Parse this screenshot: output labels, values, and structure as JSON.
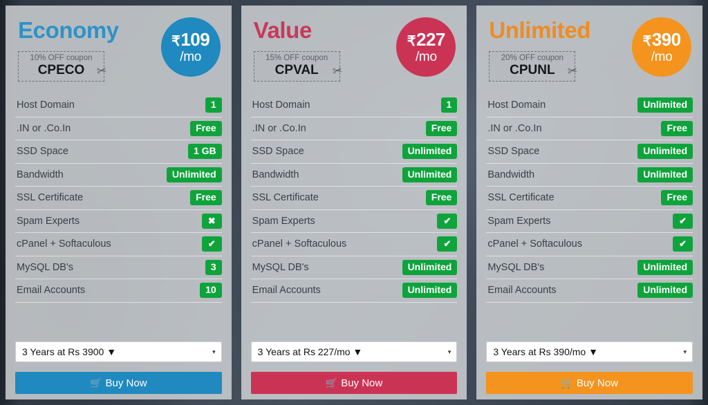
{
  "page": {
    "background_color": "#3b4450",
    "badge_color": "#0fa33c",
    "card_background": "rgba(205,208,211,0.86)"
  },
  "icons": {
    "scissors": "✂",
    "cart": "🛒",
    "check": "✔",
    "cross": "✖",
    "caret_down": "▼",
    "select_caret": "▾",
    "rupee": "₹"
  },
  "feature_labels": [
    "Host Domain",
    ".IN or .Co.In",
    "SSD Space",
    "Bandwidth",
    "SSL Certificate",
    "Spam Experts",
    "cPanel + Softaculous",
    "MySQL DB's",
    "Email Accounts"
  ],
  "plans": [
    {
      "name": "Economy",
      "name_color": "#2e92c8",
      "accent_color": "#2089bf",
      "coupon_label": "10% OFF coupon",
      "coupon_code": "CPECO",
      "price_currency": "₹",
      "price_amount": "109",
      "price_period": "/mo",
      "features": [
        {
          "label": "Host Domain",
          "value": "1",
          "type": "text"
        },
        {
          "label": ".IN or .Co.In",
          "value": "Free",
          "type": "text"
        },
        {
          "label": "SSD Space",
          "value": "1 GB",
          "type": "text"
        },
        {
          "label": "Bandwidth",
          "value": "Unlimited",
          "type": "text"
        },
        {
          "label": "SSL Certificate",
          "value": "Free",
          "type": "text"
        },
        {
          "label": "Spam Experts",
          "value": "✖",
          "type": "cross"
        },
        {
          "label": "cPanel + Softaculous",
          "value": "✔",
          "type": "check"
        },
        {
          "label": "MySQL DB's",
          "value": "3",
          "type": "text"
        },
        {
          "label": "Email Accounts",
          "value": "10",
          "type": "text"
        }
      ],
      "term_selected": "3 Years at Rs 3900 ▼",
      "buy_label": "Buy Now"
    },
    {
      "name": "Value",
      "name_color": "#c9385a",
      "accent_color": "#cb3355",
      "coupon_label": "15% OFF coupon",
      "coupon_code": "CPVAL",
      "price_currency": "₹",
      "price_amount": "227",
      "price_period": "/mo",
      "features": [
        {
          "label": "Host Domain",
          "value": "1",
          "type": "text"
        },
        {
          "label": ".IN or .Co.In",
          "value": "Free",
          "type": "text"
        },
        {
          "label": "SSD Space",
          "value": "Unlimited",
          "type": "text"
        },
        {
          "label": "Bandwidth",
          "value": "Unlimited",
          "type": "text"
        },
        {
          "label": "SSL Certificate",
          "value": "Free",
          "type": "text"
        },
        {
          "label": "Spam Experts",
          "value": "✔",
          "type": "check"
        },
        {
          "label": "cPanel + Softaculous",
          "value": "✔",
          "type": "check"
        },
        {
          "label": "MySQL DB's",
          "value": "Unlimited",
          "type": "text"
        },
        {
          "label": "Email Accounts",
          "value": "Unlimited",
          "type": "text"
        }
      ],
      "term_selected": "3 Years at Rs 227/mo ▼",
      "buy_label": "Buy Now"
    },
    {
      "name": "Unlimited",
      "name_color": "#ee8c22",
      "accent_color": "#f4931e",
      "coupon_label": "20% OFF coupon",
      "coupon_code": "CPUNL",
      "price_currency": "₹",
      "price_amount": "390",
      "price_period": "/mo",
      "features": [
        {
          "label": "Host Domain",
          "value": "Unlimited",
          "type": "text"
        },
        {
          "label": ".IN or .Co.In",
          "value": "Free",
          "type": "text"
        },
        {
          "label": "SSD Space",
          "value": "Unlimited",
          "type": "text"
        },
        {
          "label": "Bandwidth",
          "value": "Unlimited",
          "type": "text"
        },
        {
          "label": "SSL Certificate",
          "value": "Free",
          "type": "text"
        },
        {
          "label": "Spam Experts",
          "value": "✔",
          "type": "check"
        },
        {
          "label": "cPanel + Softaculous",
          "value": "✔",
          "type": "check"
        },
        {
          "label": "MySQL DB's",
          "value": "Unlimited",
          "type": "text"
        },
        {
          "label": "Email Accounts",
          "value": "Unlimited",
          "type": "text"
        }
      ],
      "term_selected": "3 Years at Rs 390/mo ▼",
      "buy_label": "Buy Now"
    }
  ]
}
